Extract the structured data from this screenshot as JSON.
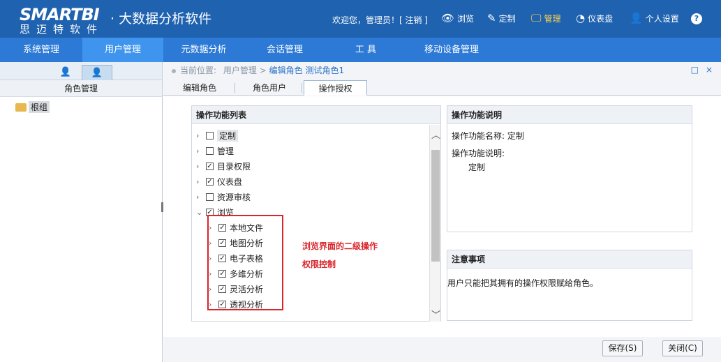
{
  "header": {
    "logo_main": "SMARTBI",
    "logo_sub": "思迈特软件",
    "title": "· 大数据分析软件",
    "welcome": "欢迎您，管理员！[ 注销 ]",
    "nav": [
      {
        "label": "浏览",
        "icon": "eye-icon",
        "glyph": "👁"
      },
      {
        "label": "定制",
        "icon": "pencil-icon",
        "glyph": "✎"
      },
      {
        "label": "管理",
        "icon": "monitor-icon",
        "glyph": "🖵"
      },
      {
        "label": "仪表盘",
        "icon": "dashboard-icon",
        "glyph": "◔"
      },
      {
        "label": "个人设置",
        "icon": "user-icon",
        "glyph": "👤"
      }
    ],
    "help": "?",
    "active_nav": "管理"
  },
  "menu": [
    "系统管理",
    "用户管理",
    "元数据分析",
    "会话管理",
    "工 具",
    "移动设备管理"
  ],
  "left": {
    "title": "角色管理",
    "tree_root": "根组",
    "tab_icons": [
      "user-icon",
      "user-icon"
    ]
  },
  "breadcrumb": {
    "prefix": "当前位置:",
    "path1": "用户管理",
    "sep": ">",
    "path2": "编辑角色",
    "path3": "测试角色1"
  },
  "window_controls": {
    "maximize": "□",
    "close": "×"
  },
  "subtabs": [
    "编辑角色",
    "角色用户",
    "操作授权"
  ],
  "funclist": {
    "title": "操作功能列表",
    "items": [
      {
        "label": "定制",
        "checked": false,
        "expanded": false,
        "level": 0
      },
      {
        "label": "管理",
        "checked": false,
        "expanded": false,
        "level": 0
      },
      {
        "label": "目录权限",
        "checked": true,
        "expanded": false,
        "level": 0
      },
      {
        "label": "仪表盘",
        "checked": true,
        "expanded": false,
        "level": 0
      },
      {
        "label": "资源审核",
        "checked": false,
        "expanded": false,
        "level": 0
      },
      {
        "label": "浏览",
        "checked": true,
        "expanded": true,
        "level": 0
      },
      {
        "label": "本地文件",
        "checked": true,
        "expanded": false,
        "level": 1
      },
      {
        "label": "地图分析",
        "checked": true,
        "expanded": false,
        "level": 1
      },
      {
        "label": "电子表格",
        "checked": true,
        "expanded": false,
        "level": 1
      },
      {
        "label": "多维分析",
        "checked": true,
        "expanded": false,
        "level": 1
      },
      {
        "label": "灵活分析",
        "checked": true,
        "expanded": false,
        "level": 1
      },
      {
        "label": "透视分析",
        "checked": true,
        "expanded": false,
        "level": 1
      }
    ],
    "annotation_line1": "浏览界面的二级操作",
    "annotation_line2": "权限控制"
  },
  "description": {
    "title": "操作功能说明",
    "name_label": "操作功能名称: 定制",
    "desc_label": "操作功能说明:",
    "desc_value": "定制"
  },
  "notes": {
    "title": "注意事项",
    "text": "用户只能把其拥有的操作权限赋给角色。"
  },
  "buttons": {
    "save": "保存(S)",
    "close": "关闭(C)"
  },
  "colors": {
    "header_bg": "#1f62b0",
    "menu_bg": "#2c7ad6",
    "menu_active": "#3f95ee",
    "annotation": "#d9252b",
    "active_nav": "#ffd54a"
  }
}
